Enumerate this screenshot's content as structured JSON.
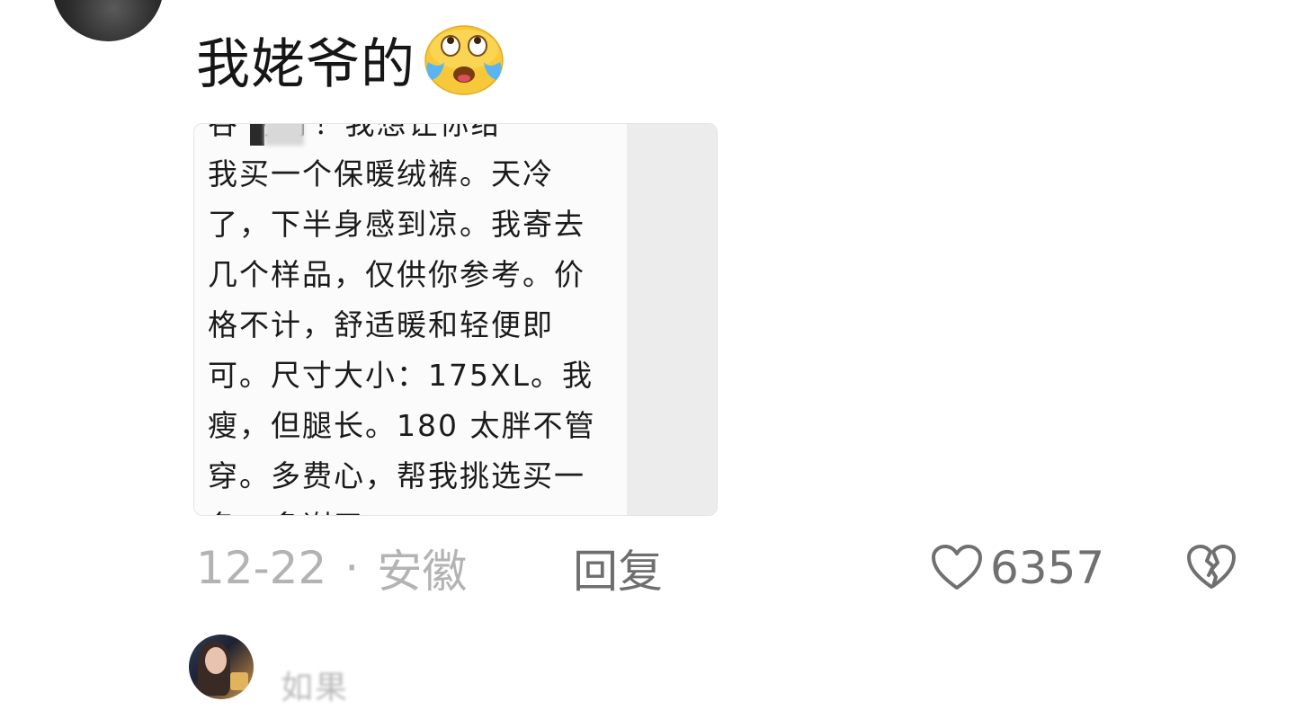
{
  "comment": {
    "text": "我姥爷的",
    "emoji": "laughing-crying-emoji",
    "attachment": {
      "lines": [
        "谷        你好！我想让你给",
        "我买一个保暖绒裤。天冷",
        "了，下半身感到凉。我寄去",
        "几个样品，仅供你参考。价",
        "格不计，舒适暖和轻便即",
        "可。尺寸大小：175XL。我",
        "瘦，但腿长。180 太胖不管",
        "穿。多费心，帮我挑选买一",
        "条。多谢了"
      ]
    },
    "date": "12-22",
    "separator": "·",
    "location": "安徽",
    "reply_label": "回复",
    "like_count": "6357",
    "like_icon": "heart-outline-icon",
    "dislike_icon": "broken-heart-icon"
  },
  "next_comment": {
    "name": "如果"
  },
  "colors": {
    "text_primary": "#161616",
    "text_meta": "#b3b3b3",
    "text_action": "#6e6e6e",
    "emoji_yellow": "#f7c93a",
    "emoji_tears": "#5ab4f0"
  }
}
